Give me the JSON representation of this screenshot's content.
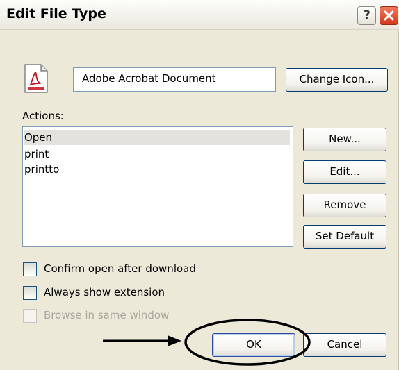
{
  "window": {
    "title": "Edit File Type",
    "help_label": "?",
    "close_label": "close"
  },
  "file_type": {
    "icon": "pdf-document-icon",
    "name_value": "Adobe Acrobat Document",
    "change_icon_label": "Change Icon..."
  },
  "actions": {
    "label": "Actions:",
    "items": [
      {
        "label": "Open",
        "selected": true
      },
      {
        "label": "print",
        "selected": false
      },
      {
        "label": "printto",
        "selected": false
      }
    ],
    "new_label": "New...",
    "edit_label": "Edit...",
    "remove_label": "Remove",
    "set_default_label": "Set Default"
  },
  "options": {
    "confirm_open": {
      "label": "Confirm open after download",
      "checked": false
    },
    "always_show_ext": {
      "label": "Always show extension",
      "checked": false
    },
    "browse_same_window": {
      "label": "Browse in same window",
      "checked": false,
      "disabled": true
    }
  },
  "footer": {
    "ok_label": "OK",
    "cancel_label": "Cancel"
  },
  "annotations": {
    "arrow": "arrow-pointing-right",
    "highlight": "ok-button-circle"
  }
}
